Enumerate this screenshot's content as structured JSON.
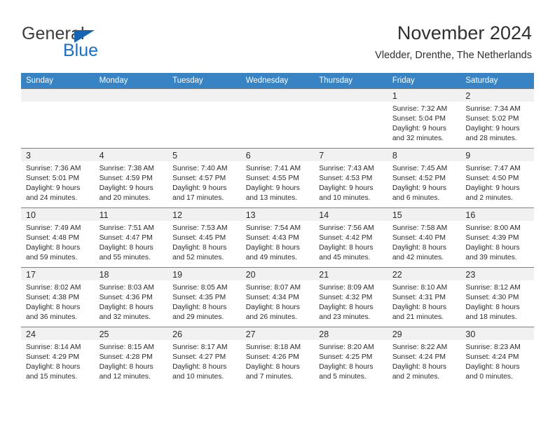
{
  "brand": {
    "name_top": "General",
    "name_bottom": "Blue",
    "triangle_icon": "blue-triangle-icon",
    "color_text": "#3c3c3c",
    "color_blue": "#1a6fc4"
  },
  "header": {
    "title": "November 2024",
    "subtitle": "Vledder, Drenthe, The Netherlands"
  },
  "theme": {
    "header_row_bg": "#3883c3",
    "header_row_text": "#ffffff",
    "daynum_band_bg": "#f1f1f1",
    "row_divider": "#7f7f7f",
    "page_bg": "#ffffff"
  },
  "weekdays": [
    "Sunday",
    "Monday",
    "Tuesday",
    "Wednesday",
    "Thursday",
    "Friday",
    "Saturday"
  ],
  "labels": {
    "sunrise_prefix": "Sunrise:",
    "sunset_prefix": "Sunset:",
    "daylight_prefix": "Daylight:"
  },
  "weeks": [
    [
      {
        "day": "",
        "lines": []
      },
      {
        "day": "",
        "lines": []
      },
      {
        "day": "",
        "lines": []
      },
      {
        "day": "",
        "lines": []
      },
      {
        "day": "",
        "lines": []
      },
      {
        "day": "1",
        "lines": [
          "Sunrise: 7:32 AM",
          "Sunset: 5:04 PM",
          "Daylight: 9 hours",
          "and 32 minutes."
        ]
      },
      {
        "day": "2",
        "lines": [
          "Sunrise: 7:34 AM",
          "Sunset: 5:02 PM",
          "Daylight: 9 hours",
          "and 28 minutes."
        ]
      }
    ],
    [
      {
        "day": "3",
        "lines": [
          "Sunrise: 7:36 AM",
          "Sunset: 5:01 PM",
          "Daylight: 9 hours",
          "and 24 minutes."
        ]
      },
      {
        "day": "4",
        "lines": [
          "Sunrise: 7:38 AM",
          "Sunset: 4:59 PM",
          "Daylight: 9 hours",
          "and 20 minutes."
        ]
      },
      {
        "day": "5",
        "lines": [
          "Sunrise: 7:40 AM",
          "Sunset: 4:57 PM",
          "Daylight: 9 hours",
          "and 17 minutes."
        ]
      },
      {
        "day": "6",
        "lines": [
          "Sunrise: 7:41 AM",
          "Sunset: 4:55 PM",
          "Daylight: 9 hours",
          "and 13 minutes."
        ]
      },
      {
        "day": "7",
        "lines": [
          "Sunrise: 7:43 AM",
          "Sunset: 4:53 PM",
          "Daylight: 9 hours",
          "and 10 minutes."
        ]
      },
      {
        "day": "8",
        "lines": [
          "Sunrise: 7:45 AM",
          "Sunset: 4:52 PM",
          "Daylight: 9 hours",
          "and 6 minutes."
        ]
      },
      {
        "day": "9",
        "lines": [
          "Sunrise: 7:47 AM",
          "Sunset: 4:50 PM",
          "Daylight: 9 hours",
          "and 2 minutes."
        ]
      }
    ],
    [
      {
        "day": "10",
        "lines": [
          "Sunrise: 7:49 AM",
          "Sunset: 4:48 PM",
          "Daylight: 8 hours",
          "and 59 minutes."
        ]
      },
      {
        "day": "11",
        "lines": [
          "Sunrise: 7:51 AM",
          "Sunset: 4:47 PM",
          "Daylight: 8 hours",
          "and 55 minutes."
        ]
      },
      {
        "day": "12",
        "lines": [
          "Sunrise: 7:53 AM",
          "Sunset: 4:45 PM",
          "Daylight: 8 hours",
          "and 52 minutes."
        ]
      },
      {
        "day": "13",
        "lines": [
          "Sunrise: 7:54 AM",
          "Sunset: 4:43 PM",
          "Daylight: 8 hours",
          "and 49 minutes."
        ]
      },
      {
        "day": "14",
        "lines": [
          "Sunrise: 7:56 AM",
          "Sunset: 4:42 PM",
          "Daylight: 8 hours",
          "and 45 minutes."
        ]
      },
      {
        "day": "15",
        "lines": [
          "Sunrise: 7:58 AM",
          "Sunset: 4:40 PM",
          "Daylight: 8 hours",
          "and 42 minutes."
        ]
      },
      {
        "day": "16",
        "lines": [
          "Sunrise: 8:00 AM",
          "Sunset: 4:39 PM",
          "Daylight: 8 hours",
          "and 39 minutes."
        ]
      }
    ],
    [
      {
        "day": "17",
        "lines": [
          "Sunrise: 8:02 AM",
          "Sunset: 4:38 PM",
          "Daylight: 8 hours",
          "and 36 minutes."
        ]
      },
      {
        "day": "18",
        "lines": [
          "Sunrise: 8:03 AM",
          "Sunset: 4:36 PM",
          "Daylight: 8 hours",
          "and 32 minutes."
        ]
      },
      {
        "day": "19",
        "lines": [
          "Sunrise: 8:05 AM",
          "Sunset: 4:35 PM",
          "Daylight: 8 hours",
          "and 29 minutes."
        ]
      },
      {
        "day": "20",
        "lines": [
          "Sunrise: 8:07 AM",
          "Sunset: 4:34 PM",
          "Daylight: 8 hours",
          "and 26 minutes."
        ]
      },
      {
        "day": "21",
        "lines": [
          "Sunrise: 8:09 AM",
          "Sunset: 4:32 PM",
          "Daylight: 8 hours",
          "and 23 minutes."
        ]
      },
      {
        "day": "22",
        "lines": [
          "Sunrise: 8:10 AM",
          "Sunset: 4:31 PM",
          "Daylight: 8 hours",
          "and 21 minutes."
        ]
      },
      {
        "day": "23",
        "lines": [
          "Sunrise: 8:12 AM",
          "Sunset: 4:30 PM",
          "Daylight: 8 hours",
          "and 18 minutes."
        ]
      }
    ],
    [
      {
        "day": "24",
        "lines": [
          "Sunrise: 8:14 AM",
          "Sunset: 4:29 PM",
          "Daylight: 8 hours",
          "and 15 minutes."
        ]
      },
      {
        "day": "25",
        "lines": [
          "Sunrise: 8:15 AM",
          "Sunset: 4:28 PM",
          "Daylight: 8 hours",
          "and 12 minutes."
        ]
      },
      {
        "day": "26",
        "lines": [
          "Sunrise: 8:17 AM",
          "Sunset: 4:27 PM",
          "Daylight: 8 hours",
          "and 10 minutes."
        ]
      },
      {
        "day": "27",
        "lines": [
          "Sunrise: 8:18 AM",
          "Sunset: 4:26 PM",
          "Daylight: 8 hours",
          "and 7 minutes."
        ]
      },
      {
        "day": "28",
        "lines": [
          "Sunrise: 8:20 AM",
          "Sunset: 4:25 PM",
          "Daylight: 8 hours",
          "and 5 minutes."
        ]
      },
      {
        "day": "29",
        "lines": [
          "Sunrise: 8:22 AM",
          "Sunset: 4:24 PM",
          "Daylight: 8 hours",
          "and 2 minutes."
        ]
      },
      {
        "day": "30",
        "lines": [
          "Sunrise: 8:23 AM",
          "Sunset: 4:24 PM",
          "Daylight: 8 hours",
          "and 0 minutes."
        ]
      }
    ]
  ]
}
